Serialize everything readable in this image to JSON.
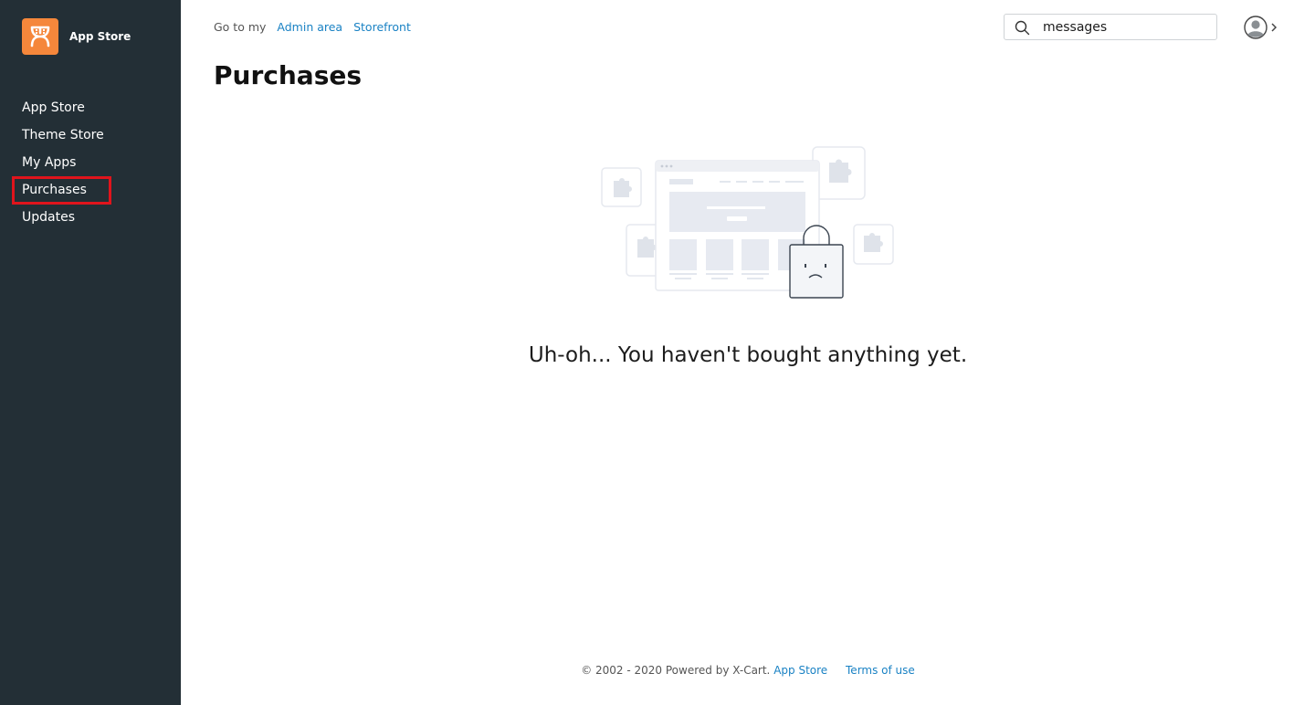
{
  "brand": {
    "name": "App Store",
    "accent": "#f5873b"
  },
  "sidebar": {
    "items": [
      {
        "label": "App Store"
      },
      {
        "label": "Theme Store"
      },
      {
        "label": "My Apps"
      },
      {
        "label": "Purchases",
        "active": true
      },
      {
        "label": "Updates"
      }
    ]
  },
  "topbar": {
    "goto_label": "Go to my",
    "admin_link": "Admin area",
    "storefront_link": "Storefront",
    "search_value": "messages"
  },
  "main": {
    "title": "Purchases",
    "empty_message": "Uh-oh... You haven't bought anything yet."
  },
  "footer": {
    "copyright": "© 2002 - 2020 Powered by X-Cart.",
    "app_store_link": "App Store",
    "terms_link": "Terms of use"
  },
  "colors": {
    "sidebar_bg": "#232f36",
    "link": "#1a82c4",
    "highlight": "#e0141c"
  }
}
